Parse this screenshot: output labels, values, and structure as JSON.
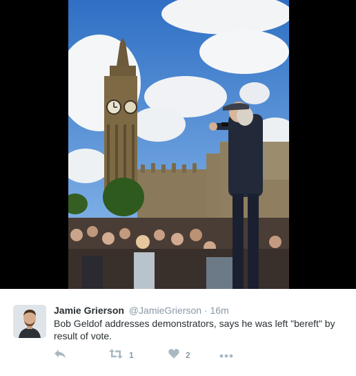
{
  "tweet": {
    "display_name": "Jamie Grierson",
    "handle": "@JamieGrierson",
    "separator": "·",
    "time": "16m",
    "text": "Bob Geldof addresses demonstrators, says he was left \"bereft\" by result of vote.",
    "actions": {
      "reply_icon": "reply-icon",
      "retweet_icon": "retweet-icon",
      "retweet_count": "1",
      "like_icon": "heart-icon",
      "like_count": "2",
      "more_icon": "more-icon"
    }
  },
  "colors": {
    "text": "#292f33",
    "muted": "#8899a6",
    "icon": "#aab8c2",
    "sky": "#3b7fd0"
  }
}
